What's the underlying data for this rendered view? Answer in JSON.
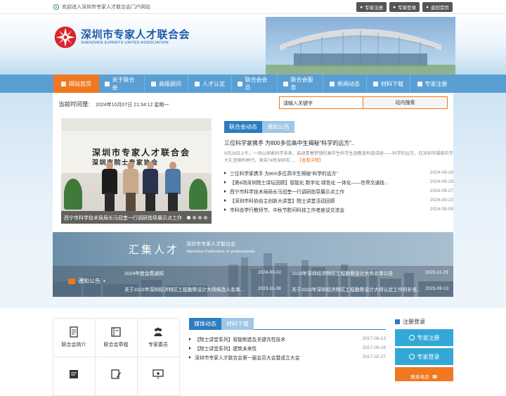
{
  "topbar": {
    "welcome": "欢迎进入深圳市专家人才联合会门户网站",
    "links": [
      "专家注册",
      "专家登录",
      "返回首页"
    ]
  },
  "logo": {
    "cn": "深圳市专家人才联合会",
    "en": "SHENZHEN EXPERTS UNITED ASSOCIATION"
  },
  "nav": {
    "items": [
      {
        "label": "网站首页",
        "icon": "home-icon"
      },
      {
        "label": "关于联合会",
        "icon": "building-icon"
      },
      {
        "label": "高级顾问",
        "icon": "user-icon"
      },
      {
        "label": "人才认定",
        "icon": "certificate-icon"
      },
      {
        "label": "联合会会员",
        "icon": "members-icon"
      },
      {
        "label": "联合会服务",
        "icon": "service-icon"
      },
      {
        "label": "新闻动态",
        "icon": "news-icon"
      },
      {
        "label": "材料下载",
        "icon": "download-icon"
      },
      {
        "label": "专家注册",
        "icon": "id-card-icon"
      }
    ]
  },
  "time": {
    "label": "当前时间是:",
    "value": "2024年10月07日 21:34:12 星期一"
  },
  "search": {
    "placeholder": "请输入关键字",
    "button": "站内搜索"
  },
  "slider": {
    "sign_line1": "深圳市专家人才联合会",
    "sign_line2": "深圳市院士专家协会",
    "caption": "西宁市科学技术局局长马冠奎一行调研指导展示点工作"
  },
  "news": {
    "tabs": [
      "联合会动态",
      "通知公告"
    ],
    "headline": "三位科学家携手 为800多位高中生揭秘“科学的远方”..",
    "summary": "9月28日上午，一场以探索科学未来、启迪青春梦想的高中生科学生涯教育科普讲座——科学的远方，在深圳市福田中学大礼堂顺利举行。来自74所深圳市.....",
    "more": "【查看详情】",
    "items": [
      {
        "title": "三位科学家携手 为800多位高中生揭秘“科学的远方”",
        "date": "2024-09-29"
      },
      {
        "title": "【第6场深圳院士讲坛回顾】智能化 数字化 绿色化 一体化——世界交通技...",
        "date": "2024-09-29"
      },
      {
        "title": "西宁市科学技术局局长马冠奎一行调研指导展示点工作",
        "date": "2024-09-27"
      },
      {
        "title": "【深圳市科协自主创新大讲堂】院士讲堂活动回顾",
        "date": "2024-09-23"
      },
      {
        "title": "市科协学行教师节、中秋节慰问科技工作者座谈交流会",
        "date": "2024-09-09"
      }
    ]
  },
  "banner": {
    "big": "汇集人才",
    "sub_cn": "深圳市专家人才联合会",
    "sub_en": "Shenzhen Federation of professionals",
    "notice_label": "通知公告",
    "items": [
      {
        "title": "2024年度会费通知",
        "date": "2024-03-02"
      },
      {
        "title": "2023年深圳经济特区工程勘察设计大师名单公告",
        "date": "2023-11-29"
      },
      {
        "title": "关于2023年深圳经济特区工程勘察设计大师候选人名单...",
        "date": "2023-11-08"
      },
      {
        "title": "关于2023年深圳经济特区工程勘察设计大师认定工作的补充...",
        "date": "2023-09-13"
      }
    ]
  },
  "quick": {
    "items": [
      {
        "label": "联合会简介",
        "icon": "document-icon"
      },
      {
        "label": "联合会章程",
        "icon": "book-icon"
      },
      {
        "label": "专家委员",
        "icon": "experts-icon"
      },
      {
        "label": "",
        "icon": "form-icon"
      },
      {
        "label": "",
        "icon": "edit-icon"
      },
      {
        "label": "",
        "icon": "presentation-icon"
      }
    ]
  },
  "bnews": {
    "tabs": [
      "媒体动态",
      "材料下载"
    ],
    "items": [
      {
        "title": "【院士讲堂系列】智能制造及关键共性技术",
        "date": "2017-06-13"
      },
      {
        "title": "【院士讲堂系列】建筑未来性",
        "date": "2017-05-16"
      },
      {
        "title": "深圳市专家人才联合会第一届会员大会暨成立大会",
        "date": "2017-02-27"
      }
    ]
  },
  "side": {
    "head": "注册登录",
    "register": "专家注册",
    "login": "专家登录",
    "phone": "联系电话"
  },
  "colors": {
    "nav": "#5a9fd4",
    "accent": "#f07820",
    "tab_active": "#2b7cc0",
    "side_btn": "#33a8d8"
  }
}
